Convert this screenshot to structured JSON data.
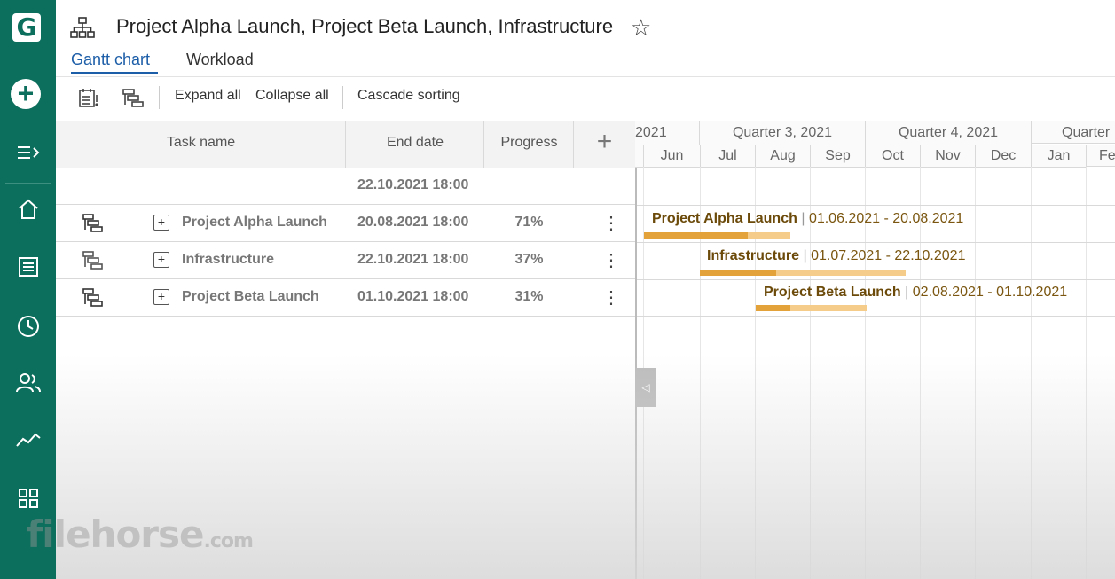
{
  "app": {
    "logo_letter": "G",
    "title": "Project Alpha Launch, Project Beta Launch, Infrastructure",
    "tabs": [
      {
        "label": "Gantt chart",
        "active": true
      },
      {
        "label": "Workload",
        "active": false
      }
    ],
    "accent_color": "#1d5ea8",
    "sidebar_color": "#0c6e5c"
  },
  "sidebar": {
    "items": [
      "create-icon",
      "expand-menu-icon",
      "home-icon",
      "list-icon",
      "clock-icon",
      "people-icon",
      "analytics-icon",
      "apps-icon"
    ]
  },
  "toolbar": {
    "expand_all": "Expand all",
    "collapse_all": "Collapse all",
    "cascade_sorting": "Cascade sorting"
  },
  "grid": {
    "headers": {
      "task_name": "Task name",
      "end_date": "End date",
      "progress": "Progress"
    },
    "summary_end_date": "22.10.2021 18:00",
    "rows": [
      {
        "name": "Project Alpha Launch",
        "end_date": "20.08.2021 18:00",
        "progress": "71%"
      },
      {
        "name": "Infrastructure",
        "end_date": "22.10.2021 18:00",
        "progress": "37%"
      },
      {
        "name": "Project Beta Launch",
        "end_date": "01.10.2021 18:00",
        "progress": "31%"
      }
    ]
  },
  "gantt": {
    "quarters": [
      "2021",
      "Quarter 3, 2021",
      "Quarter 4, 2021",
      "Quarter"
    ],
    "months": [
      "Jun",
      "Jul",
      "Aug",
      "Sep",
      "Oct",
      "Nov",
      "Dec",
      "Jan",
      "Fe"
    ],
    "bars": [
      {
        "name": "Project Alpha Launch",
        "dates": "01.06.2021 - 20.08.2021",
        "progress": 0.71
      },
      {
        "name": "Infrastructure",
        "dates": "01.07.2021 - 22.10.2021",
        "progress": 0.37
      },
      {
        "name": "Project Beta Launch",
        "dates": "02.08.2021 - 01.10.2021",
        "progress": 0.31
      }
    ]
  },
  "watermark": {
    "text": "filehorse",
    "suffix": ".com"
  }
}
